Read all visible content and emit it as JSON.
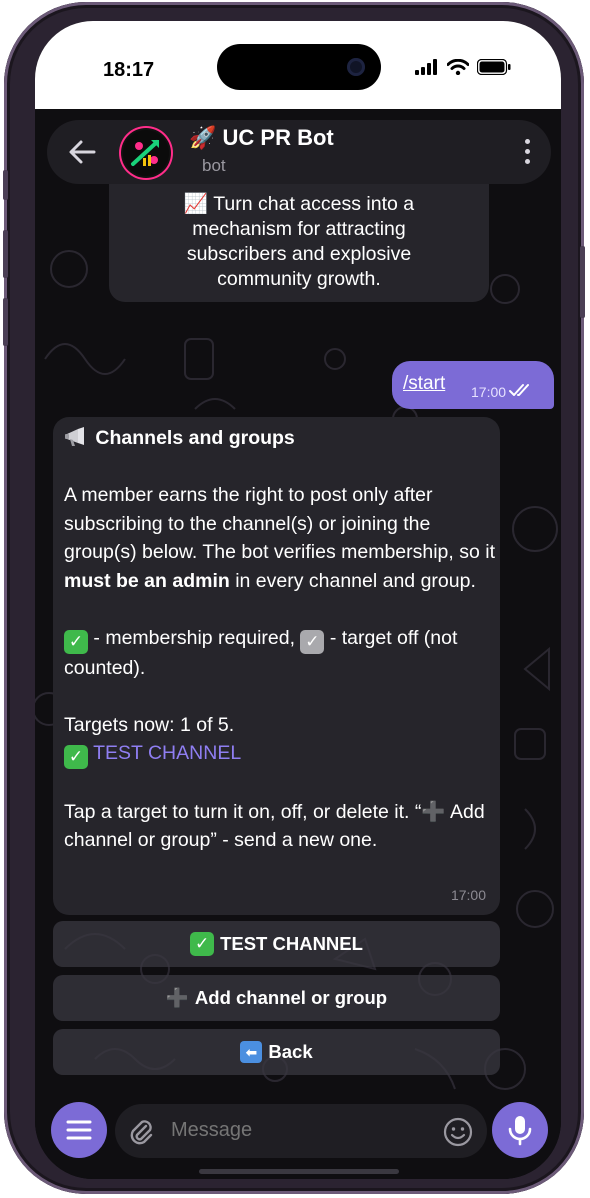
{
  "status_bar": {
    "time": "18:17"
  },
  "chat_header": {
    "title": "🚀 UC PR Bot",
    "subtitle": "bot"
  },
  "messages": {
    "top_partial": {
      "line1": "📈 Turn chat access into a",
      "line2": "mechanism for attracting",
      "line3": "subscribers and explosive",
      "line4": "community growth."
    },
    "outgoing": {
      "text": "/start",
      "time": "17:00"
    },
    "incoming": {
      "heading": "Channels and groups",
      "para1_a": "A member earns the right to post only after subscribing to the channel(s) or joining the group(s) below. The bot verifies membership, so it ",
      "para1_bold": "must be an admin",
      "para1_b": " in every channel and group.",
      "legend_a": " - membership required, ",
      "legend_b": " - target off (not counted).",
      "targets_now": "Targets now: 1 of 5.",
      "target_1": "TEST CHANNEL",
      "hint_a": "Tap a target to turn it on, off, or delete it. “",
      "hint_b": " Add channel or group” - send a new one.",
      "time": "17:00"
    }
  },
  "keyboard": {
    "btn_test_channel": "TEST CHANNEL",
    "btn_add": "Add channel or group",
    "btn_back": "Back"
  },
  "input_bar": {
    "placeholder": "Message"
  },
  "colors": {
    "accent": "#7c6bd6",
    "bubble_in": "#26252b",
    "link": "#8f7ef2",
    "check_green": "#3fb94b"
  },
  "icons": {
    "back": "back-arrow-icon",
    "more": "kebab-icon",
    "menu": "hamburger-icon",
    "attach": "paperclip-icon",
    "emoji": "smile-icon",
    "voice": "mic-icon"
  }
}
